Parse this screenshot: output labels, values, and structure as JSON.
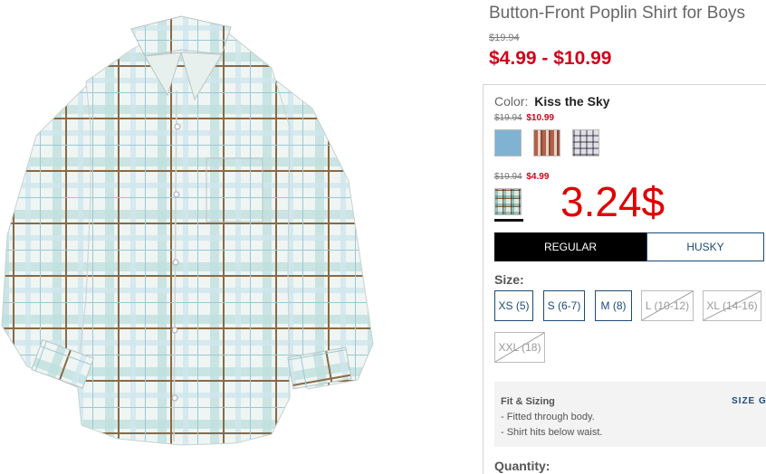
{
  "product": {
    "title": "Button-Front Poplin Shirt for Boys",
    "original_price": "$19.94",
    "price_range": "$4.99 - $10.99",
    "image_icon": "plaid-shirt-photo"
  },
  "color": {
    "label": "Color:",
    "selected_name": "Kiss the Sky",
    "group1": {
      "original_price": "$19.94",
      "sale_price": "$10.99",
      "swatches": [
        {
          "name": "light-blue-swatch",
          "color": "#7fb3d1"
        },
        {
          "name": "rust-plaid-swatch",
          "color": "#b0624a"
        },
        {
          "name": "gray-plaid-swatch",
          "color": "#b9b6bc"
        }
      ]
    },
    "group2": {
      "original_price": "$19.94",
      "sale_price": "$4.99",
      "swatches": [
        {
          "name": "kiss-the-sky-plaid-swatch",
          "color": "#a9c6c2"
        }
      ]
    }
  },
  "overlay_price": "3.24$",
  "fit_tabs": {
    "regular": "REGULAR",
    "husky": "HUSKY"
  },
  "size": {
    "label": "Size:",
    "options": [
      {
        "label": "XS (5)",
        "available": true
      },
      {
        "label": "S (6-7)",
        "available": true
      },
      {
        "label": "M (8)",
        "available": true
      },
      {
        "label": "L (10-12)",
        "available": false
      },
      {
        "label": "XL (14-16)",
        "available": false
      },
      {
        "label": "XXL (18)",
        "available": false
      }
    ]
  },
  "fit_sizing": {
    "title": "Fit & Sizing",
    "size_guide": "SIZE GU",
    "lines": [
      "- Fitted through body.",
      "- Shirt hits below waist."
    ]
  },
  "quantity": {
    "label": "Quantity:"
  },
  "colors": {
    "sale_red": "#d0021b",
    "overlay_red": "#e00000",
    "link_blue": "#1c4a7a"
  }
}
